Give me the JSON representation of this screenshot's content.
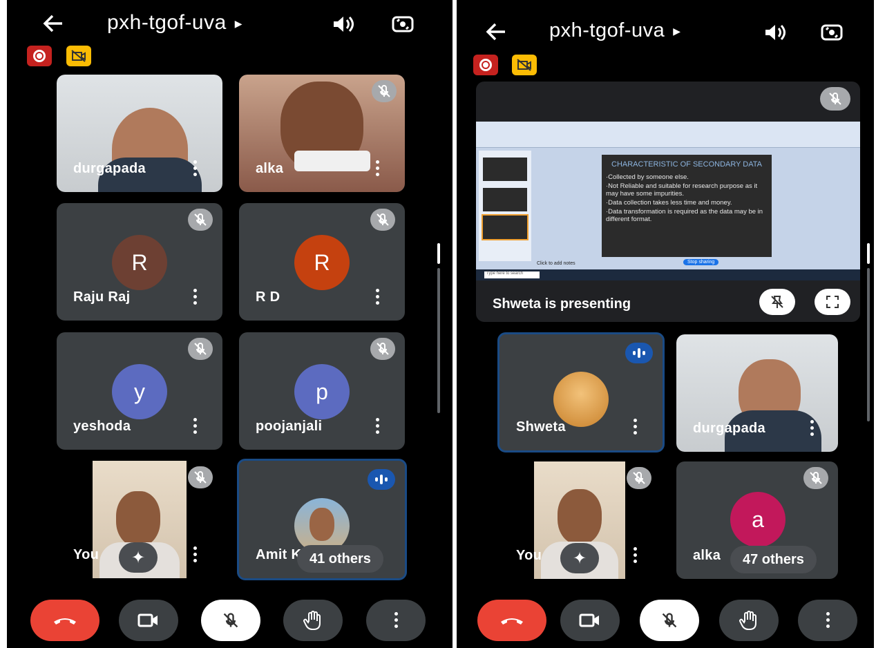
{
  "left": {
    "meeting_code": "pxh-tgof-uva",
    "tiles": [
      {
        "name": "durgapada"
      },
      {
        "name": "alka"
      },
      {
        "name": "Raju Raj",
        "initial": "R",
        "color": "#6d4033"
      },
      {
        "name": "R D",
        "initial": "R",
        "color": "#c5410f"
      },
      {
        "name": "yeshoda",
        "initial": "y",
        "color": "#5c6bc0"
      },
      {
        "name": "poojanjali",
        "initial": "p",
        "color": "#5c6bc0"
      },
      {
        "name": "You"
      },
      {
        "name": "Amit K",
        "others": "41 others"
      }
    ]
  },
  "right": {
    "meeting_code": "pxh-tgof-uva",
    "presenting_label": "Shweta is presenting",
    "slide": {
      "title": "CHARACTERISTIC OF SECONDARY DATA",
      "bullets": [
        "·Collected by someone else.",
        "·Not Reliable and suitable for research purpose as it may have some impurities.",
        "·Data collection takes less time and money.",
        "·Data transformation is required as the data may be in different format."
      ],
      "notes_placeholder": "Click to add notes",
      "stop_sharing": "Stop sharing",
      "search": "Type here to search"
    },
    "tiles": [
      {
        "name": "Shweta"
      },
      {
        "name": "durgapada"
      },
      {
        "name": "You"
      },
      {
        "name": "alka",
        "initial": "a",
        "color": "#c2185b",
        "others": "47 others"
      }
    ]
  },
  "icons": [
    "back-arrow-icon",
    "volume-icon",
    "switch-camera-icon",
    "record-icon",
    "camera-off-icon",
    "mic-off-icon",
    "more-icon",
    "end-call-icon",
    "camera-icon",
    "raise-hand-icon",
    "sparkle-effects-icon",
    "speaking-icon",
    "pin-off-icon",
    "fullscreen-icon"
  ]
}
